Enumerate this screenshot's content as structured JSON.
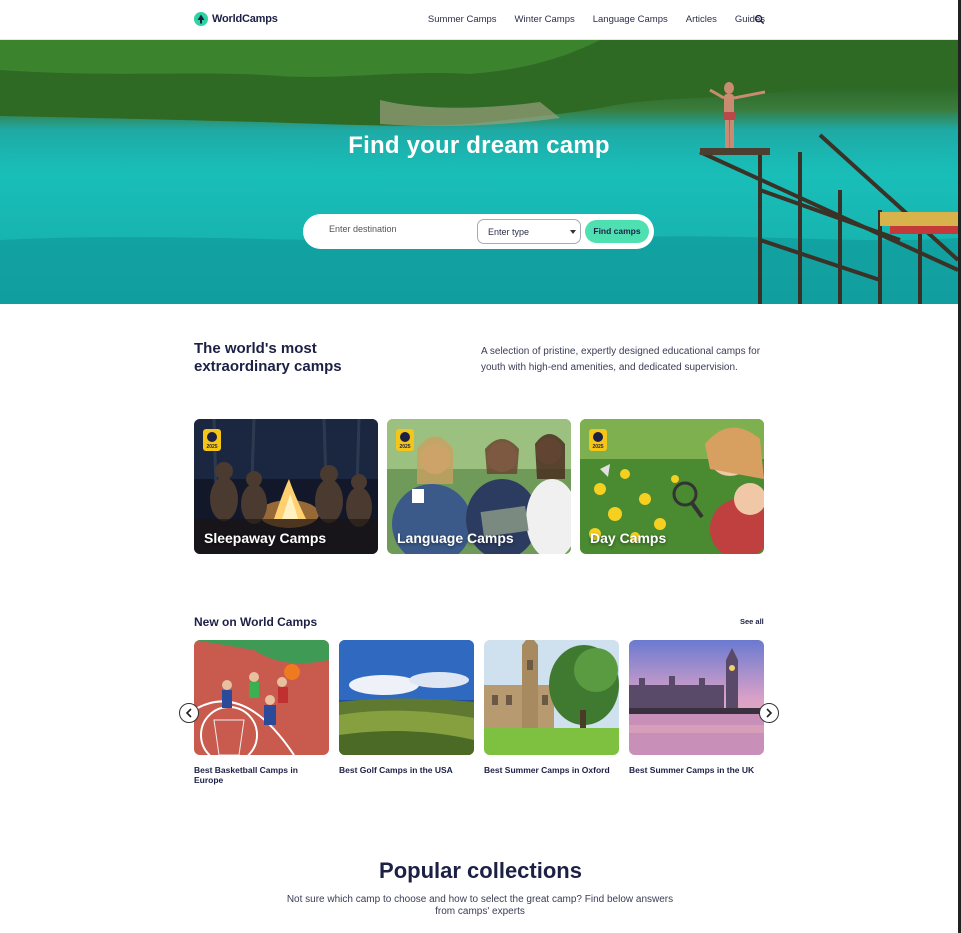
{
  "header": {
    "logo_text": "WorldCamps",
    "nav": [
      "Summer Camps",
      "Winter Camps",
      "Language Camps",
      "Articles",
      "Guides"
    ]
  },
  "hero": {
    "title": "Find your dream camp",
    "destination_placeholder": "Enter destination",
    "type_select_value": "Enter type",
    "find_button": "Find camps"
  },
  "intro": {
    "title": "The world's most extraordinary camps",
    "text": "A selection of pristine, expertly designed educational camps for youth with high-end amenities, and dedicated supervision."
  },
  "categories": [
    {
      "label": "Sleepaway Camps",
      "badge": "2025"
    },
    {
      "label": "Language Camps",
      "badge": "2025"
    },
    {
      "label": "Day Camps",
      "badge": "2025"
    }
  ],
  "new_section": {
    "title": "New on World Camps",
    "see_all": "See all",
    "items": [
      {
        "label": "Best Basketball Camps in Europe"
      },
      {
        "label": "Best Golf Camps in the USA"
      },
      {
        "label": "Best Summer Camps in Oxford"
      },
      {
        "label": "Best Summer Camps in the UK"
      }
    ]
  },
  "popular": {
    "title": "Popular collections",
    "text": "Not sure which camp to choose and how to select the great camp? Find below answers from camps' experts"
  },
  "colors": {
    "accent": "#4fe0b2",
    "navy": "#1c2045"
  }
}
